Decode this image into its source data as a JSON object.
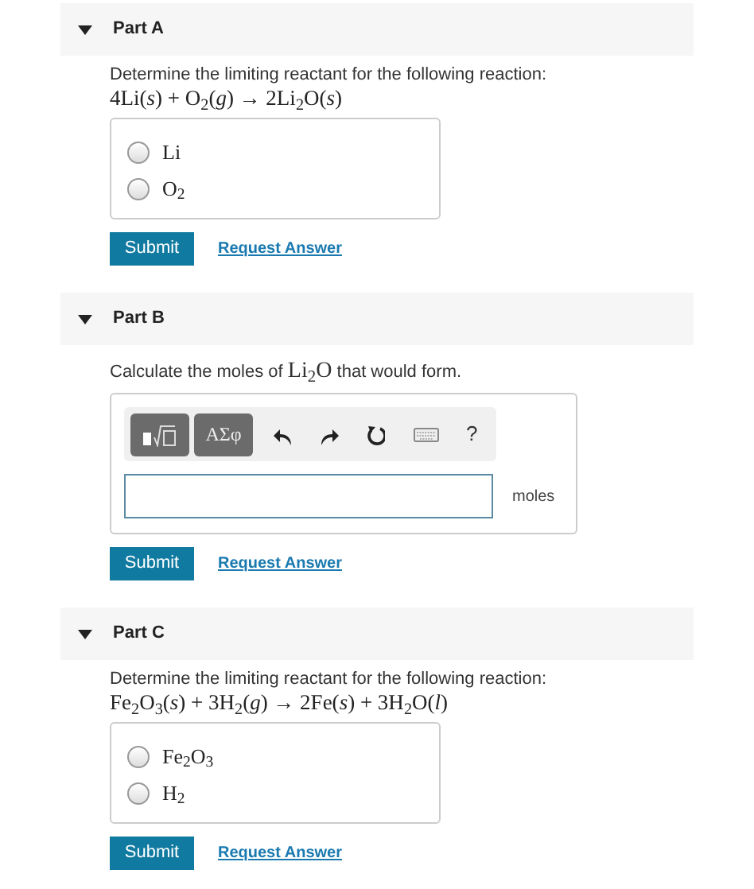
{
  "parts": [
    {
      "title": "Part A",
      "expanded": true,
      "kind": "choice",
      "question": "Determine the limiting reactant for the following reaction:",
      "equation": "4Li(*s*) + O$_{2}$(*g*) → 2Li$_{2}$O(*s*)",
      "choices": [
        {
          "label": "Li",
          "selected": false
        },
        {
          "label": "O$_{2}$",
          "selected": false
        }
      ],
      "submit": "Submit",
      "request": "Request Answer"
    },
    {
      "title": "Part B",
      "expanded": true,
      "kind": "numeric",
      "question": [
        {
          "kind": "text",
          "text": "Calculate the moles of "
        },
        {
          "kind": "formula",
          "text": "Li$_{2}$O"
        },
        {
          "kind": "text",
          "text": " that would form."
        }
      ],
      "toolbar": {
        "greek": "ΑΣφ",
        "help": "?"
      },
      "unit": "moles",
      "submit": "Submit",
      "request": "Request Answer"
    },
    {
      "title": "Part C",
      "expanded": true,
      "kind": "choice",
      "question": "Determine the limiting reactant for the following reaction:",
      "equation": "Fe$_{2}$O$_{3}$(*s*) + 3H$_{2}$(*g*) → 2Fe(*s*) + 3H$_{2}$O(*l*)",
      "choices": [
        {
          "label": "Fe$_{2}$O$_{3}$",
          "selected": false
        },
        {
          "label": "H$_{2}$",
          "selected": false
        }
      ],
      "submit": "Submit",
      "request": "Request Answer"
    }
  ]
}
